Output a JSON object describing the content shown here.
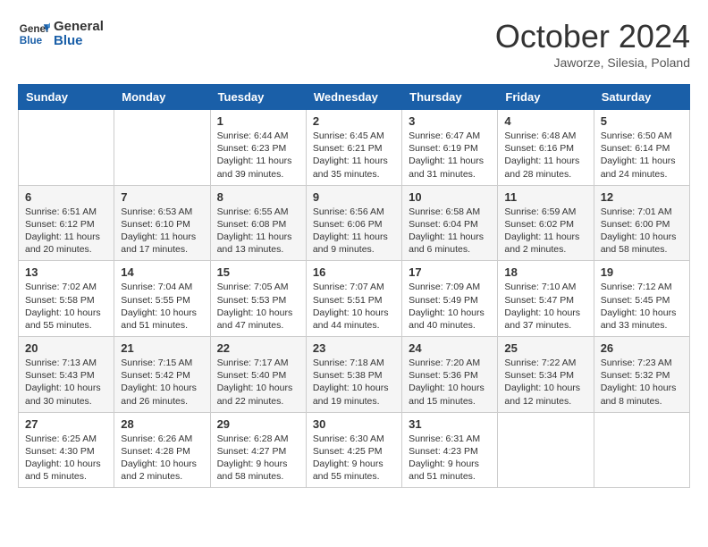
{
  "header": {
    "logo_line1": "General",
    "logo_line2": "Blue",
    "month": "October 2024",
    "location": "Jaworze, Silesia, Poland"
  },
  "weekdays": [
    "Sunday",
    "Monday",
    "Tuesday",
    "Wednesday",
    "Thursday",
    "Friday",
    "Saturday"
  ],
  "weeks": [
    [
      {
        "day": "",
        "sunrise": "",
        "sunset": "",
        "daylight": ""
      },
      {
        "day": "",
        "sunrise": "",
        "sunset": "",
        "daylight": ""
      },
      {
        "day": "1",
        "sunrise": "Sunrise: 6:44 AM",
        "sunset": "Sunset: 6:23 PM",
        "daylight": "Daylight: 11 hours and 39 minutes."
      },
      {
        "day": "2",
        "sunrise": "Sunrise: 6:45 AM",
        "sunset": "Sunset: 6:21 PM",
        "daylight": "Daylight: 11 hours and 35 minutes."
      },
      {
        "day": "3",
        "sunrise": "Sunrise: 6:47 AM",
        "sunset": "Sunset: 6:19 PM",
        "daylight": "Daylight: 11 hours and 31 minutes."
      },
      {
        "day": "4",
        "sunrise": "Sunrise: 6:48 AM",
        "sunset": "Sunset: 6:16 PM",
        "daylight": "Daylight: 11 hours and 28 minutes."
      },
      {
        "day": "5",
        "sunrise": "Sunrise: 6:50 AM",
        "sunset": "Sunset: 6:14 PM",
        "daylight": "Daylight: 11 hours and 24 minutes."
      }
    ],
    [
      {
        "day": "6",
        "sunrise": "Sunrise: 6:51 AM",
        "sunset": "Sunset: 6:12 PM",
        "daylight": "Daylight: 11 hours and 20 minutes."
      },
      {
        "day": "7",
        "sunrise": "Sunrise: 6:53 AM",
        "sunset": "Sunset: 6:10 PM",
        "daylight": "Daylight: 11 hours and 17 minutes."
      },
      {
        "day": "8",
        "sunrise": "Sunrise: 6:55 AM",
        "sunset": "Sunset: 6:08 PM",
        "daylight": "Daylight: 11 hours and 13 minutes."
      },
      {
        "day": "9",
        "sunrise": "Sunrise: 6:56 AM",
        "sunset": "Sunset: 6:06 PM",
        "daylight": "Daylight: 11 hours and 9 minutes."
      },
      {
        "day": "10",
        "sunrise": "Sunrise: 6:58 AM",
        "sunset": "Sunset: 6:04 PM",
        "daylight": "Daylight: 11 hours and 6 minutes."
      },
      {
        "day": "11",
        "sunrise": "Sunrise: 6:59 AM",
        "sunset": "Sunset: 6:02 PM",
        "daylight": "Daylight: 11 hours and 2 minutes."
      },
      {
        "day": "12",
        "sunrise": "Sunrise: 7:01 AM",
        "sunset": "Sunset: 6:00 PM",
        "daylight": "Daylight: 10 hours and 58 minutes."
      }
    ],
    [
      {
        "day": "13",
        "sunrise": "Sunrise: 7:02 AM",
        "sunset": "Sunset: 5:58 PM",
        "daylight": "Daylight: 10 hours and 55 minutes."
      },
      {
        "day": "14",
        "sunrise": "Sunrise: 7:04 AM",
        "sunset": "Sunset: 5:55 PM",
        "daylight": "Daylight: 10 hours and 51 minutes."
      },
      {
        "day": "15",
        "sunrise": "Sunrise: 7:05 AM",
        "sunset": "Sunset: 5:53 PM",
        "daylight": "Daylight: 10 hours and 47 minutes."
      },
      {
        "day": "16",
        "sunrise": "Sunrise: 7:07 AM",
        "sunset": "Sunset: 5:51 PM",
        "daylight": "Daylight: 10 hours and 44 minutes."
      },
      {
        "day": "17",
        "sunrise": "Sunrise: 7:09 AM",
        "sunset": "Sunset: 5:49 PM",
        "daylight": "Daylight: 10 hours and 40 minutes."
      },
      {
        "day": "18",
        "sunrise": "Sunrise: 7:10 AM",
        "sunset": "Sunset: 5:47 PM",
        "daylight": "Daylight: 10 hours and 37 minutes."
      },
      {
        "day": "19",
        "sunrise": "Sunrise: 7:12 AM",
        "sunset": "Sunset: 5:45 PM",
        "daylight": "Daylight: 10 hours and 33 minutes."
      }
    ],
    [
      {
        "day": "20",
        "sunrise": "Sunrise: 7:13 AM",
        "sunset": "Sunset: 5:43 PM",
        "daylight": "Daylight: 10 hours and 30 minutes."
      },
      {
        "day": "21",
        "sunrise": "Sunrise: 7:15 AM",
        "sunset": "Sunset: 5:42 PM",
        "daylight": "Daylight: 10 hours and 26 minutes."
      },
      {
        "day": "22",
        "sunrise": "Sunrise: 7:17 AM",
        "sunset": "Sunset: 5:40 PM",
        "daylight": "Daylight: 10 hours and 22 minutes."
      },
      {
        "day": "23",
        "sunrise": "Sunrise: 7:18 AM",
        "sunset": "Sunset: 5:38 PM",
        "daylight": "Daylight: 10 hours and 19 minutes."
      },
      {
        "day": "24",
        "sunrise": "Sunrise: 7:20 AM",
        "sunset": "Sunset: 5:36 PM",
        "daylight": "Daylight: 10 hours and 15 minutes."
      },
      {
        "day": "25",
        "sunrise": "Sunrise: 7:22 AM",
        "sunset": "Sunset: 5:34 PM",
        "daylight": "Daylight: 10 hours and 12 minutes."
      },
      {
        "day": "26",
        "sunrise": "Sunrise: 7:23 AM",
        "sunset": "Sunset: 5:32 PM",
        "daylight": "Daylight: 10 hours and 8 minutes."
      }
    ],
    [
      {
        "day": "27",
        "sunrise": "Sunrise: 6:25 AM",
        "sunset": "Sunset: 4:30 PM",
        "daylight": "Daylight: 10 hours and 5 minutes."
      },
      {
        "day": "28",
        "sunrise": "Sunrise: 6:26 AM",
        "sunset": "Sunset: 4:28 PM",
        "daylight": "Daylight: 10 hours and 2 minutes."
      },
      {
        "day": "29",
        "sunrise": "Sunrise: 6:28 AM",
        "sunset": "Sunset: 4:27 PM",
        "daylight": "Daylight: 9 hours and 58 minutes."
      },
      {
        "day": "30",
        "sunrise": "Sunrise: 6:30 AM",
        "sunset": "Sunset: 4:25 PM",
        "daylight": "Daylight: 9 hours and 55 minutes."
      },
      {
        "day": "31",
        "sunrise": "Sunrise: 6:31 AM",
        "sunset": "Sunset: 4:23 PM",
        "daylight": "Daylight: 9 hours and 51 minutes."
      },
      {
        "day": "",
        "sunrise": "",
        "sunset": "",
        "daylight": ""
      },
      {
        "day": "",
        "sunrise": "",
        "sunset": "",
        "daylight": ""
      }
    ]
  ]
}
